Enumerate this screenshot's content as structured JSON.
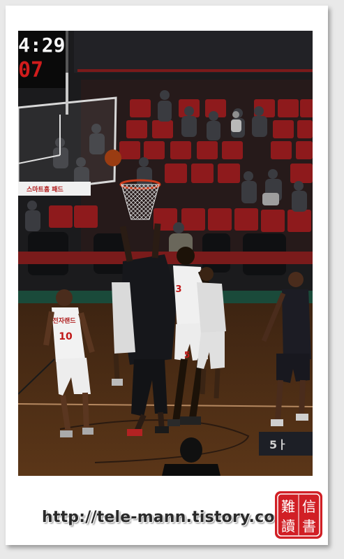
{
  "photo": {
    "scoreboard": {
      "time": "4:29",
      "score": "07"
    },
    "ad_board": "스마트홈 패드",
    "players": [
      {
        "team": "white",
        "number": "10",
        "team_text": "전자랜드"
      },
      {
        "team": "white",
        "number": "3"
      },
      {
        "team": "white",
        "number": "5"
      }
    ]
  },
  "caption": {
    "url": "http://tele-mann.tistory.com"
  },
  "seal": {
    "chars": [
      "難",
      "信",
      "讀",
      "書"
    ]
  },
  "colors": {
    "seats": "#8e1a1c",
    "floor": "#5a3318",
    "seal": "#d11f25"
  }
}
